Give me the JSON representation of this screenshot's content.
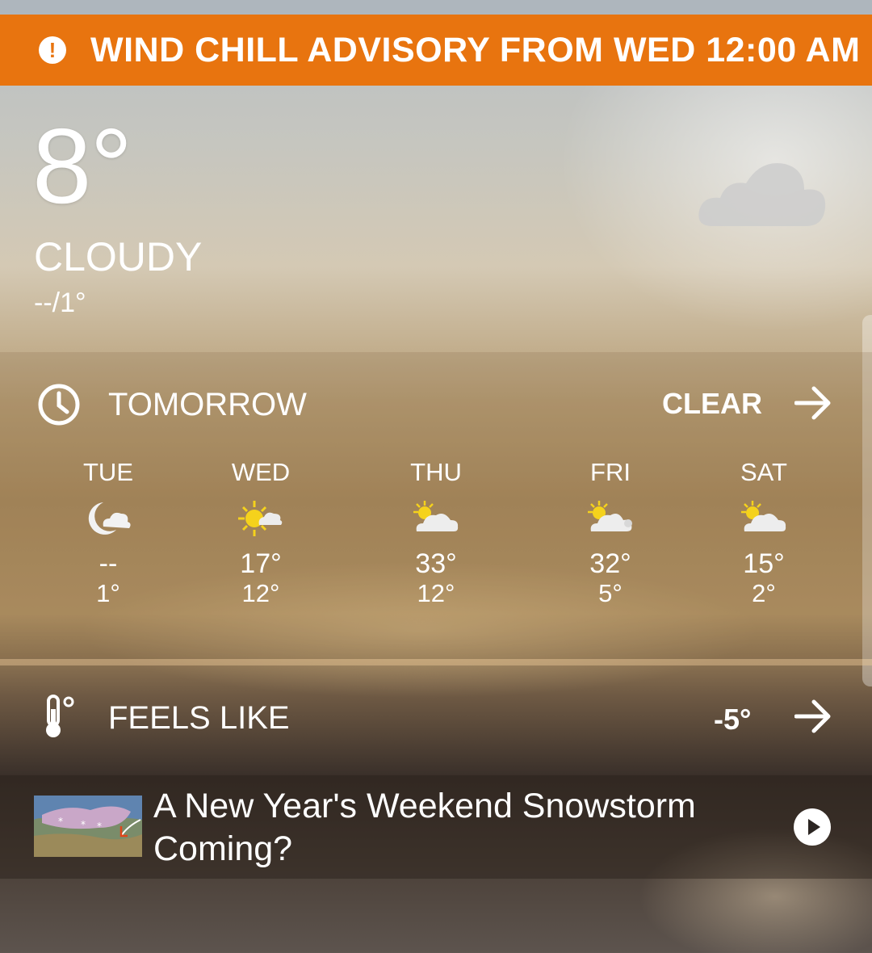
{
  "advisory": {
    "text": "WIND CHILL ADVISORY FROM WED 12:00 AM",
    "icon": "alert-icon",
    "color": "#e8740f"
  },
  "current": {
    "temperature": "8°",
    "condition": "CLOUDY",
    "hi_lo": "--/1°",
    "icon": "cloud-icon"
  },
  "tomorrow": {
    "title": "TOMORROW",
    "summary": "CLEAR",
    "icon": "clock-icon",
    "days": [
      {
        "name": "TUE",
        "icon": "moon-cloud-icon",
        "high": "--",
        "low": "1°"
      },
      {
        "name": "WED",
        "icon": "sun-cloud-icon",
        "high": "17°",
        "low": "12°"
      },
      {
        "name": "THU",
        "icon": "partly-cloudy-icon",
        "high": "33°",
        "low": "12°"
      },
      {
        "name": "FRI",
        "icon": "partly-cloudy-icon",
        "high": "32°",
        "low": "5°"
      },
      {
        "name": "SAT",
        "icon": "partly-cloudy-icon",
        "high": "15°",
        "low": "2°"
      }
    ]
  },
  "feels_like": {
    "title": "FEELS LIKE",
    "value": "-5°",
    "icon": "thermometer-icon"
  },
  "news": {
    "title": "A New Year's Weekend Snowstorm Coming?",
    "icon": "play-icon"
  }
}
